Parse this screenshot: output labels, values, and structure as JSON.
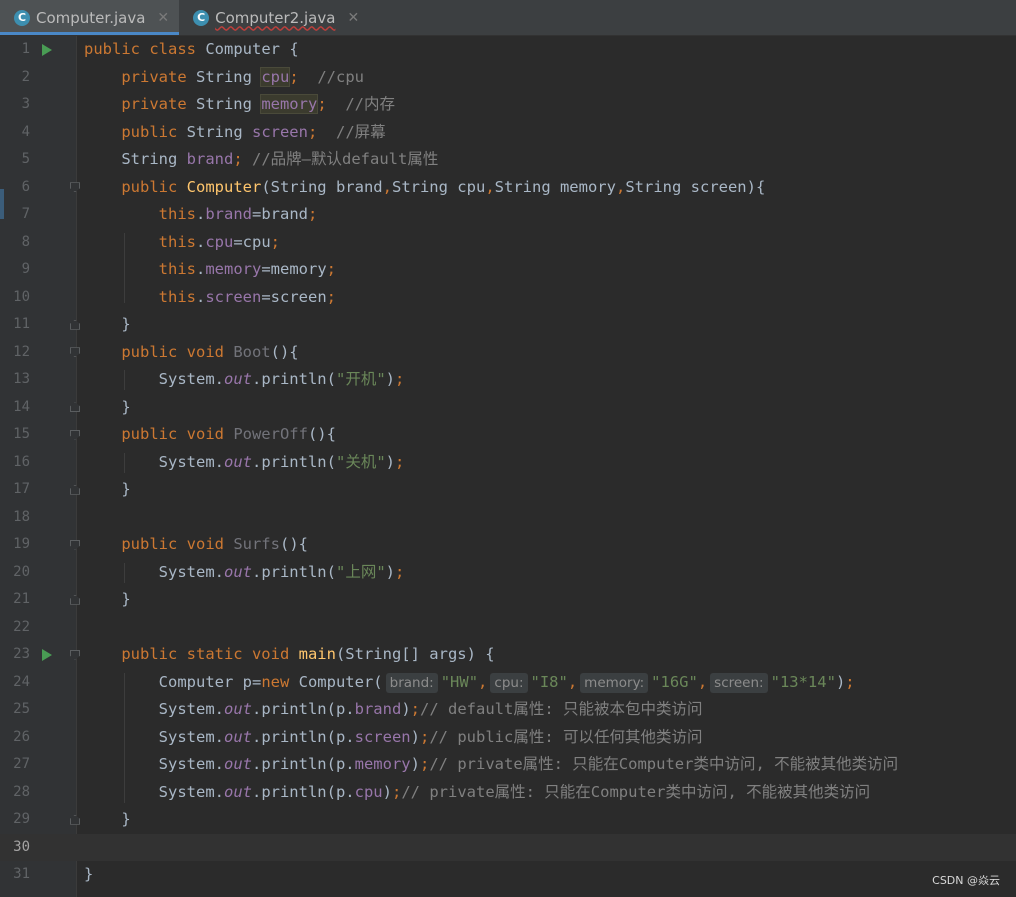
{
  "tabs": [
    {
      "label": "Computer.java",
      "icon": "java-class-icon",
      "active": true,
      "squiggle": false
    },
    {
      "label": "Computer2.java",
      "icon": "java-class-icon",
      "active": false,
      "squiggle": true
    }
  ],
  "current_line": 30,
  "watermark": "CSDN @焱云",
  "lines": [
    {
      "n": "1",
      "gutter": "run",
      "tokens": [
        [
          "kw",
          "public class "
        ],
        [
          "t",
          "Computer {"
        ]
      ]
    },
    {
      "n": "2",
      "gutter": "",
      "tokens": [
        [
          "t",
          "    "
        ],
        [
          "kw",
          "private "
        ],
        [
          "t",
          "String "
        ],
        [
          "fldhl",
          "cpu"
        ],
        [
          "kw",
          ";"
        ],
        [
          "t",
          "  "
        ],
        [
          "cmt",
          "//cpu"
        ]
      ]
    },
    {
      "n": "3",
      "gutter": "",
      "tokens": [
        [
          "t",
          "    "
        ],
        [
          "kw",
          "private "
        ],
        [
          "t",
          "String "
        ],
        [
          "fldhl",
          "memory"
        ],
        [
          "kw",
          ";"
        ],
        [
          "t",
          "  "
        ],
        [
          "cmt",
          "//内存"
        ]
      ]
    },
    {
      "n": "4",
      "gutter": "",
      "tokens": [
        [
          "t",
          "    "
        ],
        [
          "kw",
          "public "
        ],
        [
          "t",
          "String "
        ],
        [
          "fld",
          "screen"
        ],
        [
          "kw",
          ";"
        ],
        [
          "t",
          "  "
        ],
        [
          "cmt",
          "//屏幕"
        ]
      ]
    },
    {
      "n": "5",
      "gutter": "",
      "tokens": [
        [
          "t",
          "    String "
        ],
        [
          "fld",
          "brand"
        ],
        [
          "kw",
          "; "
        ],
        [
          "cmt",
          "//品牌—默认default属性"
        ]
      ]
    },
    {
      "n": "6",
      "gutter": "fold-open",
      "tokens": [
        [
          "t",
          "    "
        ],
        [
          "kw",
          "public "
        ],
        [
          "fn",
          "Computer"
        ],
        [
          "t",
          "(String brand"
        ],
        [
          "kw",
          ","
        ],
        [
          "t",
          "String cpu"
        ],
        [
          "kw",
          ","
        ],
        [
          "t",
          "String memory"
        ],
        [
          "kw",
          ","
        ],
        [
          "t",
          "String screen){"
        ]
      ]
    },
    {
      "n": "7",
      "gutter": "",
      "tokens": [
        [
          "t",
          "        "
        ],
        [
          "kw",
          "this"
        ],
        [
          "t",
          "."
        ],
        [
          "fld",
          "brand"
        ],
        [
          "t",
          "=brand"
        ],
        [
          "kw",
          ";"
        ]
      ]
    },
    {
      "n": "8",
      "gutter": "",
      "tokens": [
        [
          "t",
          "        "
        ],
        [
          "kw",
          "this"
        ],
        [
          "t",
          "."
        ],
        [
          "fld",
          "cpu"
        ],
        [
          "t",
          "=cpu"
        ],
        [
          "kw",
          ";"
        ]
      ]
    },
    {
      "n": "9",
      "gutter": "",
      "tokens": [
        [
          "t",
          "        "
        ],
        [
          "kw",
          "this"
        ],
        [
          "t",
          "."
        ],
        [
          "fld",
          "memory"
        ],
        [
          "t",
          "=memory"
        ],
        [
          "kw",
          ";"
        ]
      ]
    },
    {
      "n": "10",
      "gutter": "",
      "tokens": [
        [
          "t",
          "        "
        ],
        [
          "kw",
          "this"
        ],
        [
          "t",
          "."
        ],
        [
          "fld",
          "screen"
        ],
        [
          "t",
          "=screen"
        ],
        [
          "kw",
          ";"
        ]
      ]
    },
    {
      "n": "11",
      "gutter": "fold-close",
      "tokens": [
        [
          "t",
          "    }"
        ]
      ]
    },
    {
      "n": "12",
      "gutter": "fold-open",
      "tokens": [
        [
          "t",
          "    "
        ],
        [
          "kw",
          "public void "
        ],
        [
          "unused",
          "Boot"
        ],
        [
          "t",
          "(){"
        ]
      ]
    },
    {
      "n": "13",
      "gutter": "",
      "tokens": [
        [
          "t",
          "        System."
        ],
        [
          "sfld",
          "out"
        ],
        [
          "t",
          ".println("
        ],
        [
          "str",
          "\"开机\""
        ],
        [
          "t",
          ")"
        ],
        [
          "kw",
          ";"
        ]
      ]
    },
    {
      "n": "14",
      "gutter": "fold-close",
      "tokens": [
        [
          "t",
          "    }"
        ]
      ]
    },
    {
      "n": "15",
      "gutter": "fold-open",
      "tokens": [
        [
          "t",
          "    "
        ],
        [
          "kw",
          "public void "
        ],
        [
          "unused",
          "PowerOff"
        ],
        [
          "t",
          "(){"
        ]
      ]
    },
    {
      "n": "16",
      "gutter": "",
      "tokens": [
        [
          "t",
          "        System."
        ],
        [
          "sfld",
          "out"
        ],
        [
          "t",
          ".println("
        ],
        [
          "str",
          "\"关机\""
        ],
        [
          "t",
          ")"
        ],
        [
          "kw",
          ";"
        ]
      ]
    },
    {
      "n": "17",
      "gutter": "fold-close",
      "tokens": [
        [
          "t",
          "    }"
        ]
      ]
    },
    {
      "n": "18",
      "gutter": "",
      "tokens": []
    },
    {
      "n": "19",
      "gutter": "fold-open",
      "tokens": [
        [
          "t",
          "    "
        ],
        [
          "kw",
          "public void "
        ],
        [
          "unused",
          "Surfs"
        ],
        [
          "t",
          "(){"
        ]
      ]
    },
    {
      "n": "20",
      "gutter": "",
      "tokens": [
        [
          "t",
          "        System."
        ],
        [
          "sfld",
          "out"
        ],
        [
          "t",
          ".println("
        ],
        [
          "str",
          "\"上网\""
        ],
        [
          "t",
          ")"
        ],
        [
          "kw",
          ";"
        ]
      ]
    },
    {
      "n": "21",
      "gutter": "fold-close",
      "tokens": [
        [
          "t",
          "    }"
        ]
      ]
    },
    {
      "n": "22",
      "gutter": "",
      "tokens": []
    },
    {
      "n": "23",
      "gutter": "run-fold",
      "tokens": [
        [
          "t",
          "    "
        ],
        [
          "kw",
          "public static void "
        ],
        [
          "fn",
          "main"
        ],
        [
          "t",
          "(String[] args) {"
        ]
      ]
    },
    {
      "n": "24",
      "gutter": "",
      "tokens": [
        [
          "t",
          "        Computer p="
        ],
        [
          "kw",
          "new "
        ],
        [
          "t",
          "Computer("
        ],
        [
          "hint",
          "brand:"
        ],
        [
          "str",
          "\"HW\""
        ],
        [
          "kw",
          ","
        ],
        [
          "hint",
          "cpu:"
        ],
        [
          "str",
          "\"I8\""
        ],
        [
          "kw",
          ","
        ],
        [
          "hint",
          "memory:"
        ],
        [
          "str",
          "\"16G\""
        ],
        [
          "kw",
          ","
        ],
        [
          "hint",
          "screen:"
        ],
        [
          "str",
          "\"13*14\""
        ],
        [
          "t",
          ")"
        ],
        [
          "kw",
          ";"
        ]
      ]
    },
    {
      "n": "25",
      "gutter": "",
      "tokens": [
        [
          "t",
          "        System."
        ],
        [
          "sfld",
          "out"
        ],
        [
          "t",
          ".println(p."
        ],
        [
          "fld",
          "brand"
        ],
        [
          "t",
          ")"
        ],
        [
          "kw",
          ";"
        ],
        [
          "cmt",
          "// default属性: 只能被本包中类访问"
        ]
      ]
    },
    {
      "n": "26",
      "gutter": "",
      "tokens": [
        [
          "t",
          "        System."
        ],
        [
          "sfld",
          "out"
        ],
        [
          "t",
          ".println(p."
        ],
        [
          "fld",
          "screen"
        ],
        [
          "t",
          ")"
        ],
        [
          "kw",
          ";"
        ],
        [
          "cmt",
          "// public属性: 可以任何其他类访问"
        ]
      ]
    },
    {
      "n": "27",
      "gutter": "",
      "tokens": [
        [
          "t",
          "        System."
        ],
        [
          "sfld",
          "out"
        ],
        [
          "t",
          ".println(p."
        ],
        [
          "fld",
          "memory"
        ],
        [
          "t",
          ")"
        ],
        [
          "kw",
          ";"
        ],
        [
          "cmt",
          "// private属性: 只能在Computer类中访问, 不能被其他类访问"
        ]
      ]
    },
    {
      "n": "28",
      "gutter": "",
      "tokens": [
        [
          "t",
          "        System."
        ],
        [
          "sfld",
          "out"
        ],
        [
          "t",
          ".println(p."
        ],
        [
          "fld",
          "cpu"
        ],
        [
          "t",
          ")"
        ],
        [
          "kw",
          ";"
        ],
        [
          "cmt",
          "// private属性: 只能在Computer类中访问, 不能被其他类访问"
        ]
      ]
    },
    {
      "n": "29",
      "gutter": "fold-close",
      "tokens": [
        [
          "t",
          "    }"
        ]
      ]
    },
    {
      "n": "30",
      "gutter": "",
      "tokens": []
    },
    {
      "n": "31",
      "gutter": "",
      "tokens": [
        [
          "t",
          "}"
        ]
      ]
    }
  ]
}
